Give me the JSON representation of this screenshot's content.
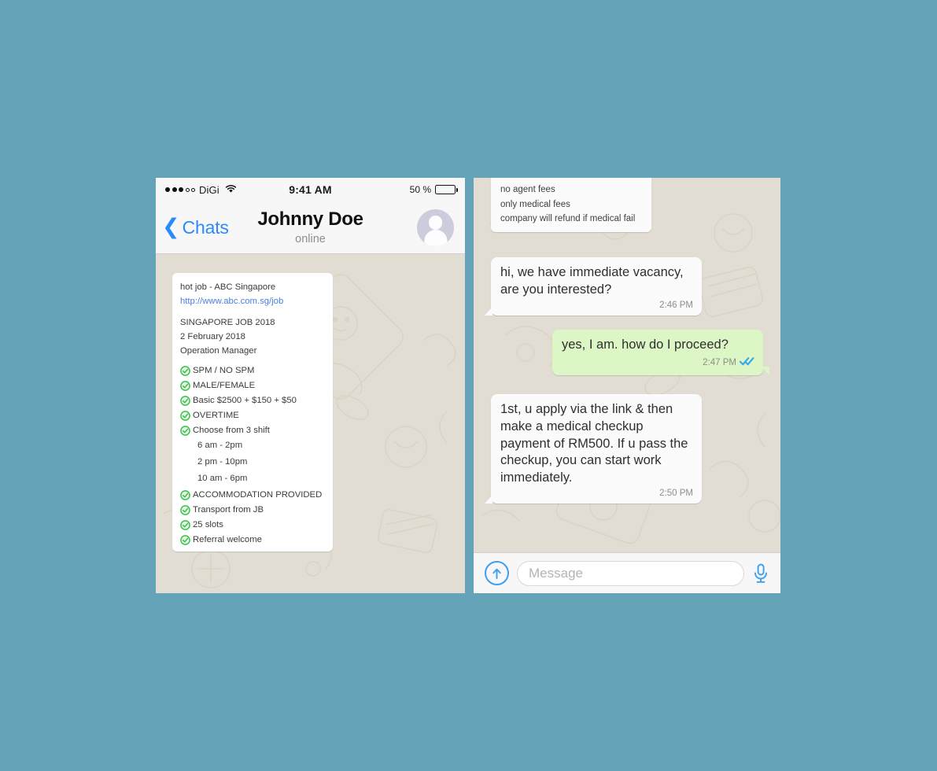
{
  "canvas": {
    "background": "#65a4b8"
  },
  "left_phone": {
    "status_bar": {
      "signal_filled": 3,
      "signal_hollow": 2,
      "carrier": "DiGi",
      "wifi_icon": "wifi-icon",
      "time": "9:41 AM",
      "battery_percent": "50 %",
      "battery_level": 50
    },
    "nav": {
      "back_icon": "chevron-left-icon",
      "back_label": "Chats",
      "title": "Johnny Doe",
      "status": "online",
      "avatar_icon": "user-avatar-icon"
    },
    "job_message": {
      "title": "hot job - ABC Singapore",
      "link": "http://www.abc.com.sg/job",
      "info_lines": [
        "SINGAPORE JOB 2018",
        "2 February 2018",
        "Operation Manager"
      ],
      "checklist": [
        {
          "text": "SPM / NO SPM",
          "checked": true
        },
        {
          "text": "MALE/FEMALE",
          "checked": true
        },
        {
          "text": "Basic $2500 + $150 + $50",
          "checked": true
        },
        {
          "text": "OVERTIME",
          "checked": true
        },
        {
          "text": "Choose from 3 shift",
          "checked": true
        },
        {
          "text": "6 am - 2pm",
          "checked": false
        },
        {
          "text": "2 pm - 10pm",
          "checked": false
        },
        {
          "text": "10 am - 6pm",
          "checked": false
        },
        {
          "text": "ACCOMMODATION PROVIDED",
          "checked": true
        },
        {
          "text": "Transport from JB",
          "checked": true
        },
        {
          "text": "25 slots",
          "checked": true
        },
        {
          "text": "Referral welcome",
          "checked": true
        }
      ]
    }
  },
  "right_phone": {
    "messages": {
      "fees": {
        "lines": [
          "no agent fees",
          "only medical fees",
          "company will refund if medical fail"
        ]
      },
      "hi": {
        "text": "hi, we have immediate vacancy, are you interested?",
        "time": "2:46 PM"
      },
      "yes": {
        "text": "yes, I am. how do I proceed?",
        "time": "2:47 PM",
        "ticks_icon": "double-check-icon"
      },
      "first": {
        "text": "1st, u apply via the link & then make a medical checkup payment of RM500. If u pass the checkup, you can start work immediately.",
        "time": "2:50 PM"
      }
    },
    "input_bar": {
      "send_icon": "arrow-up-circle-icon",
      "placeholder": "Message",
      "value": "",
      "mic_icon": "microphone-icon"
    }
  },
  "colors": {
    "accent_blue": "#2b8afc",
    "outgoing_bubble": "#dcf7c5",
    "incoming_bubble": "#fbfbfb",
    "chat_background": "#e2ddd3",
    "check_green": "#3cc14a",
    "tick_blue": "#34b7f1"
  }
}
